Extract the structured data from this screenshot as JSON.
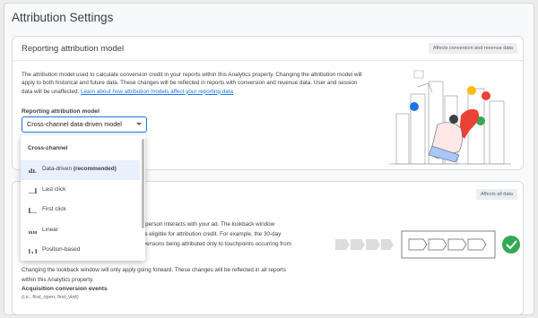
{
  "page": {
    "title": "Attribution Settings"
  },
  "reporting_card": {
    "title": "Reporting attribution model",
    "chip": "Affects conversion and revenue data",
    "description_lines": [
      "The attribution model used to calculate conversion credit in your reports within this Analytics property. Changing the",
      "attribution model will apply to both historical and future data. These changes will be reflected in reports with conversion and",
      "revenue data. User and session data will be unaffected. "
    ],
    "learn_more": "Learn about how attribution models affect your reporting data",
    "field_label": "Reporting attribution model",
    "selected_value": "Cross-channel data-driven model"
  },
  "dropdown": {
    "group_header": "Cross-channel",
    "items": [
      {
        "label": "Data-driven",
        "suffix": "(recommended)",
        "icon": "bar-chart-icon"
      },
      {
        "label": "Last click",
        "suffix": "",
        "icon": "last-click-icon"
      },
      {
        "label": "First click",
        "suffix": "",
        "icon": "first-click-icon"
      },
      {
        "label": "Linear",
        "suffix": "",
        "icon": "linear-icon"
      },
      {
        "label": "Position-based",
        "suffix": "",
        "icon": "position-based-icon"
      }
    ]
  },
  "lookback_card": {
    "chip": "Affects all data",
    "partial_lines": [
      "r a person interacts with your ad. The lookback window",
      "nt is eligible for attribution credit. For example, the 30-day",
      "onversions being attributed only to touchpoints occurring from"
    ],
    "note_lines": [
      "Changing the lookback window will only apply going forward. These changes will be reflected in all reports",
      "within this Analytics property."
    ],
    "field_label": "Acquisition conversion events",
    "field_sub": "(i.e., first_open, first_visit)"
  },
  "colors": {
    "accent": "#1a73e8",
    "success": "#34a853",
    "illustration_red": "#ea4335"
  }
}
